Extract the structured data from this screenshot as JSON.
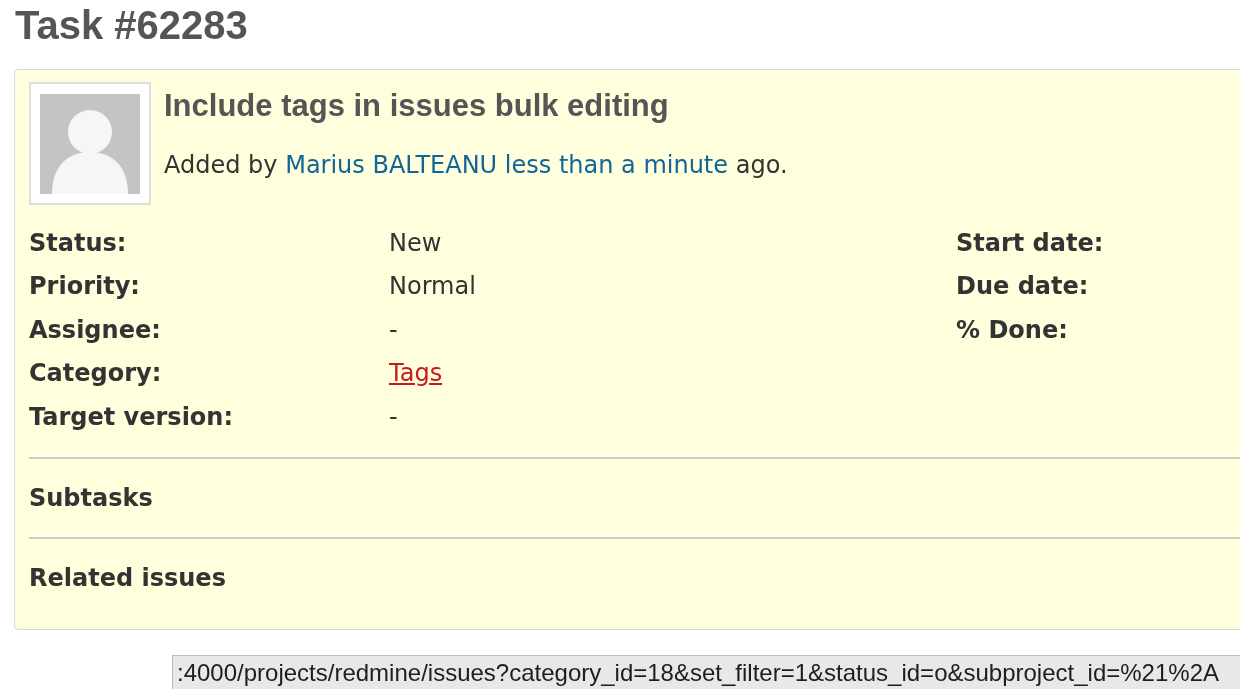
{
  "page_title": "Task #62283",
  "issue": {
    "subject": "Include tags in issues bulk editing",
    "author_line": {
      "prefix": "Added by",
      "author": "Marius BALTEANU",
      "age": "less than a minute",
      "suffix": "ago."
    },
    "attributes_left": [
      {
        "label": "Status:",
        "value": "New"
      },
      {
        "label": "Priority:",
        "value": "Normal"
      },
      {
        "label": "Assignee:",
        "value": "-"
      },
      {
        "label": "Category:",
        "link": {
          "text": "Tags",
          "hovered": true
        }
      },
      {
        "label": "Target version:",
        "value": "-"
      }
    ],
    "attributes_right": [
      {
        "label": "Start date:"
      },
      {
        "label": "Due date:"
      },
      {
        "label": "% Done:"
      }
    ],
    "sections": [
      {
        "title": "Subtasks"
      },
      {
        "title": "Related issues"
      }
    ]
  },
  "status_bar": {
    "url": ":4000/projects/redmine/issues?category_id=18&set_filter=1&status_id=o&subproject_id=%21%2A"
  }
}
